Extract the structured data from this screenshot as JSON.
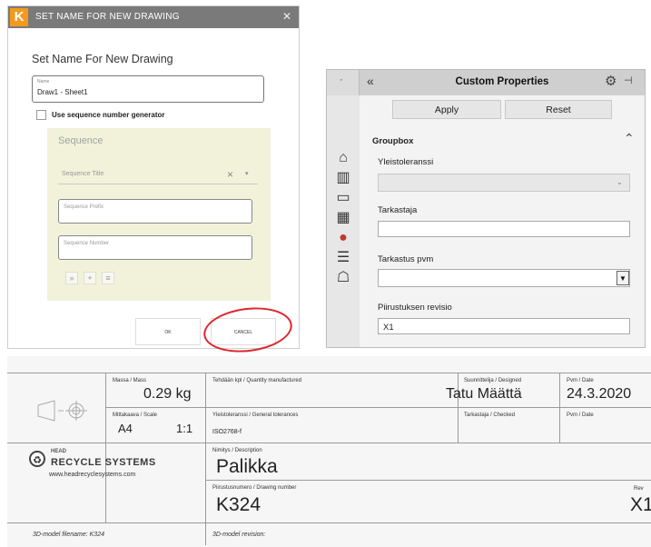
{
  "dialog": {
    "title": "SET NAME FOR NEW DRAWING",
    "logo_letter": "K",
    "heading": "Set Name For New Drawing",
    "name_field": {
      "label": "Name",
      "value": "Draw1 - Sheet1"
    },
    "sequence_checkbox_label": "Use sequence number generator",
    "sequence": {
      "heading": "Sequence",
      "title_placeholder": "Sequence Title",
      "prefix_placeholder": "Sequence Prefix",
      "number_placeholder": "Sequence Number",
      "tools": [
        "»",
        "+",
        "≡"
      ]
    },
    "ok_label": "OK",
    "cancel_label": "CANCEL",
    "accent_color": "#f39a1e",
    "highlight_color": "#e0242b"
  },
  "properties": {
    "title": "Custom Properties",
    "apply_label": "Apply",
    "reset_label": "Reset",
    "groupbox_label": "Groupbox",
    "fields": [
      {
        "label": "Yleistoleranssi",
        "value": ""
      },
      {
        "label": "Tarkastaja",
        "value": ""
      },
      {
        "label": "Tarkastus pvm",
        "value": ""
      },
      {
        "label": "Piirustuksen revisio",
        "value": "X1"
      }
    ],
    "sidebar_icons": [
      "home-icon",
      "part-icon",
      "folder-icon",
      "palette-icon",
      "appearance-icon",
      "list-icon",
      "chat-icon"
    ]
  },
  "title_block": {
    "mass_label": "Massa / Mass",
    "mass_value": "0.29 kg",
    "quantity_label": "Tehdään kpl / Quantity manufactured",
    "designed_label": "Suunnittelija / Designed",
    "designed_value": "Tatu Määttä",
    "date_label": "Pvm / Date",
    "date_value": "24.3.2020",
    "scale_label": "Mittakaava / Scale",
    "paper_size": "A4",
    "scale_value": "1:1",
    "tolerance_label": "Yleistoleranssi / General tolerances",
    "tolerance_value": "ISO2768-f",
    "checked_label": "Tarkastaja / Checked",
    "date_label_2": "Pvm / Date",
    "description_label": "Nimitys / Description",
    "description_value": "Palikka",
    "drawing_number_label": "Piirustusnumero / Drawing number",
    "drawing_number_value": "K324",
    "rev_label": "Rev",
    "rev_value": "X1",
    "brand_top": "HEAD",
    "brand": "RECYCLE SYSTEMS",
    "website": "www.headrecyclesystems.com",
    "model_filename": "3D-model filename: K324",
    "model_revision": "3D-model revision:"
  }
}
